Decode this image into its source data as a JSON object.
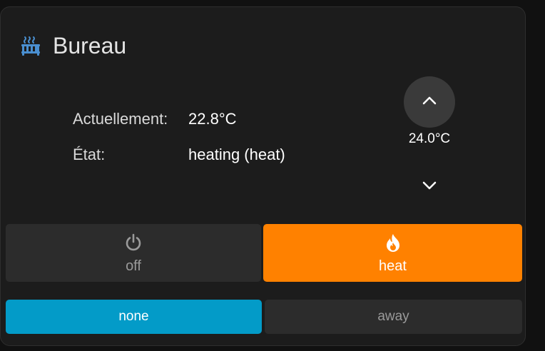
{
  "card": {
    "title": "Bureau",
    "icon": "radiator-icon",
    "accent_color": "#4a8fd0"
  },
  "info": {
    "current_label": "Actuellement:",
    "current_value": "22.8°C",
    "state_label": "État:",
    "state_value": "heating (heat)"
  },
  "target": {
    "value": "24.0°C",
    "up_icon": "chevron-up-icon",
    "down_icon": "chevron-down-icon"
  },
  "modes": [
    {
      "label": "off",
      "icon": "power-icon",
      "active": false,
      "color": "#2c2c2c"
    },
    {
      "label": "heat",
      "icon": "fire-icon",
      "active": true,
      "color": "#ff8100"
    }
  ],
  "presets": [
    {
      "label": "none",
      "active": true,
      "color": "#039bc8"
    },
    {
      "label": "away",
      "active": false,
      "color": "#2c2c2c"
    }
  ]
}
